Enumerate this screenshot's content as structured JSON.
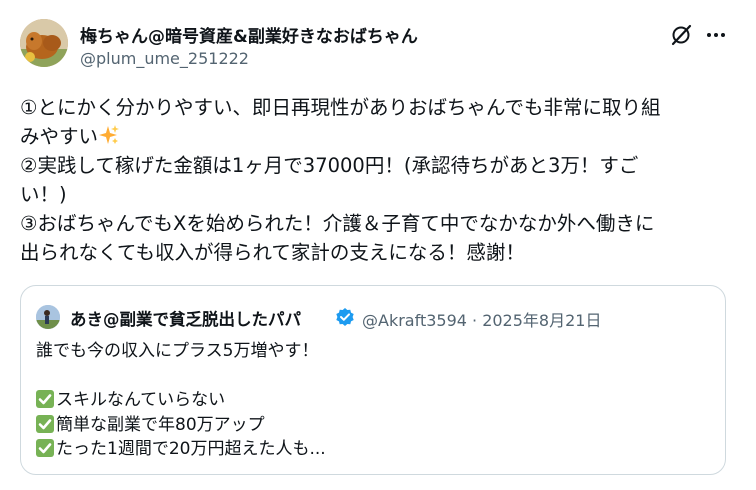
{
  "author": {
    "display_name": "梅ちゃん@暗号資産&副業好きなおばちゃん",
    "handle": "@plum_ume_251222"
  },
  "post": {
    "line1": "①とにかく分かりやすい、即日再現性がありおばちゃんでも非常に取り組",
    "line2": "みやすい",
    "line3": "②実践して稼げた金額は1ヶ月で37000円！(承認待ちがあと3万！すご",
    "line4": "い！)",
    "line5": "③おばちゃんでもXを始められた！介護＆子育て中でなかなか外へ働きに",
    "line6": "出られなくても収入が得られて家計の支えになる！感謝！"
  },
  "quote": {
    "display_name": "あき@副業で貧乏脱出したパパ",
    "meta": "@Akraft3594 · 2025年8月21日",
    "line1": "誰でも今の収入にプラス5万増やす！",
    "item1": "スキルなんていらない",
    "item2": "簡単な副業で年80万アップ",
    "item3": "たった1週間で20万円超えた人も..."
  },
  "icons": {
    "grok": "grok-icon",
    "more": "more-icon",
    "verified": "verified-badge-icon",
    "sparkles": "sparkles-emoji-icon",
    "check": "check-mark-button-emoji-icon"
  },
  "colors": {
    "text": "#0f1419",
    "secondary": "#536471",
    "border": "#cfd9de",
    "verified": "#1d9bf0",
    "check_green": "#77b255"
  }
}
